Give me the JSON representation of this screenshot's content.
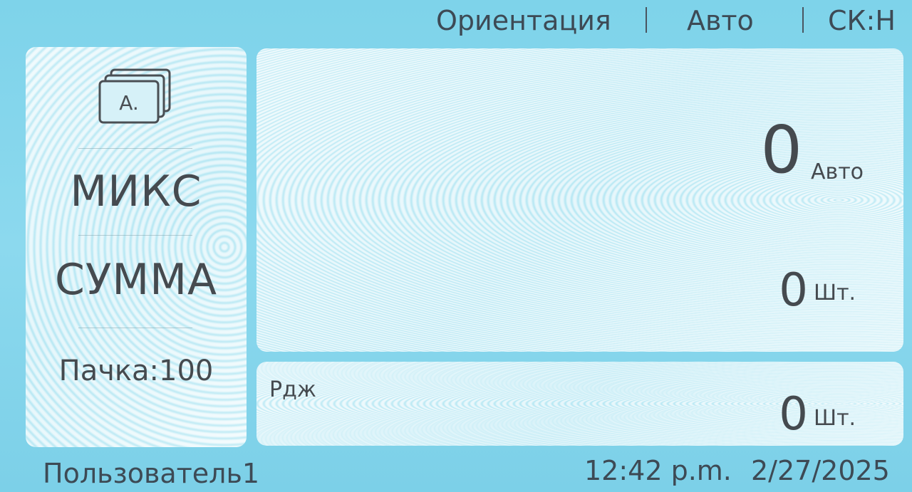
{
  "header": {
    "orientation_label": "Ориентация",
    "mode_label": "Авто",
    "counterfeit_label": "СК:Н"
  },
  "left_panel": {
    "icon": "stacked-banknotes-icon",
    "icon_text": "A.",
    "mix_label": "МИКС",
    "sum_label": "СУММА",
    "batch_label": "Пачка:100"
  },
  "main_display": {
    "total_value": "0",
    "total_unit": "Авто",
    "count_value": "0",
    "count_unit": "Шт."
  },
  "reject_display": {
    "label": "Рдж",
    "count_value": "0",
    "count_unit": "Шт."
  },
  "footer": {
    "user": "Пользователь1",
    "time": "12:42 p.m.",
    "date": "2/27/2025"
  },
  "colors": {
    "background": "#7ed3ea",
    "panel": "#d6f1f8",
    "text": "#454a4f"
  }
}
